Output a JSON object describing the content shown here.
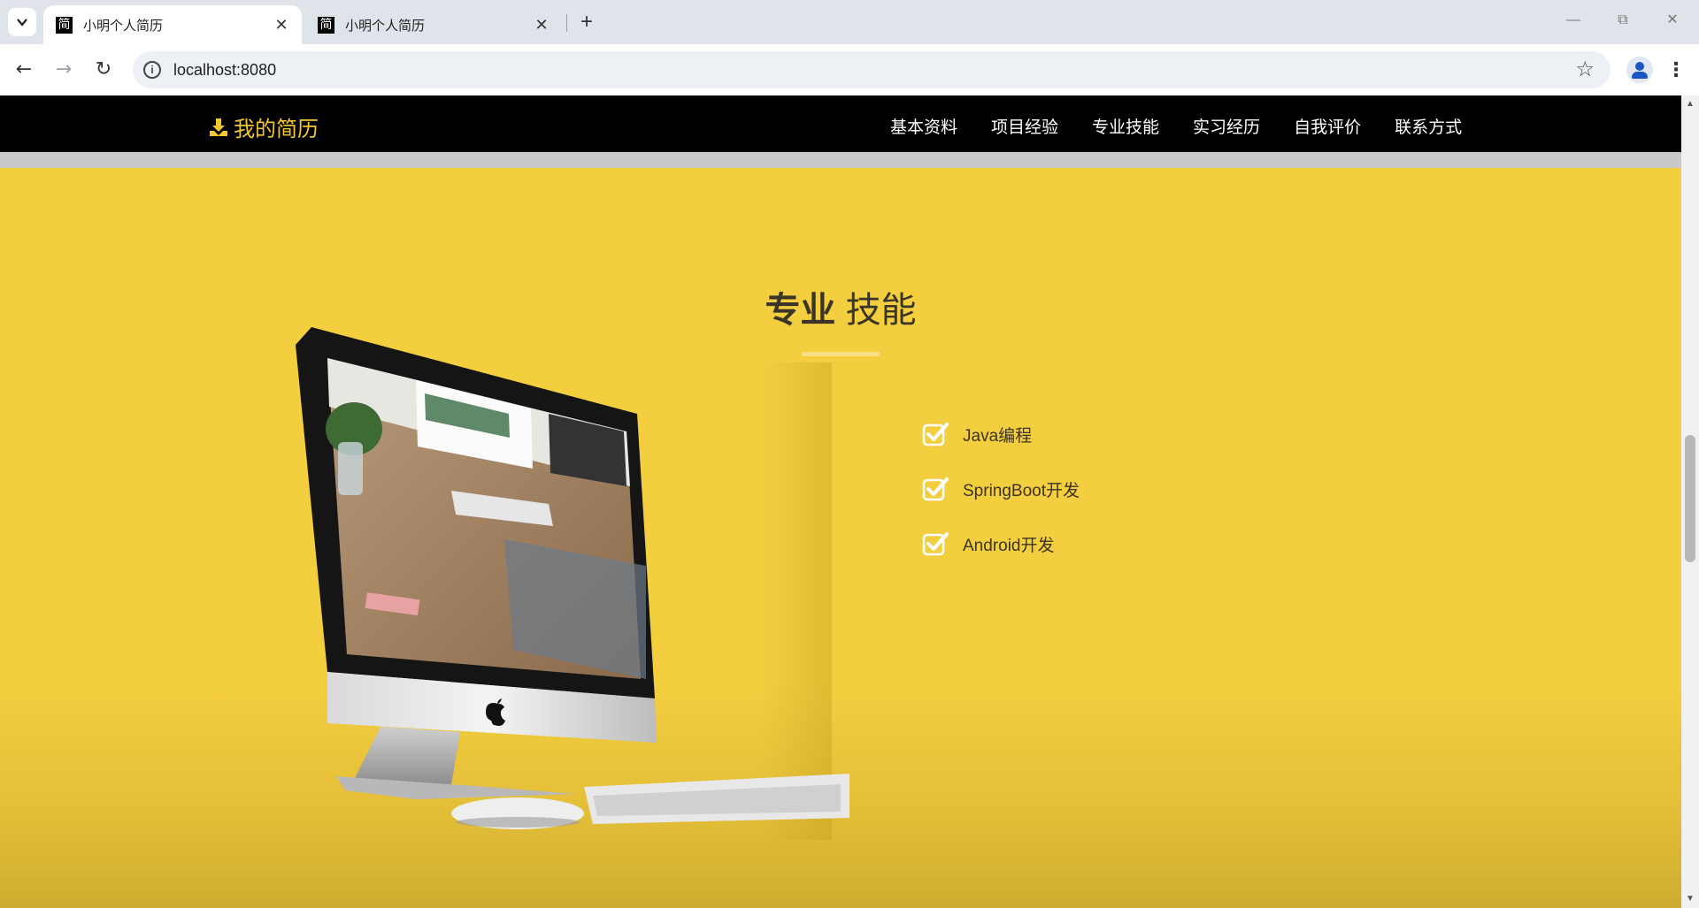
{
  "browser": {
    "tabs": [
      {
        "favicon": "简",
        "title": "小明个人简历",
        "active": true
      },
      {
        "favicon": "简",
        "title": "小明个人简历",
        "active": false
      }
    ],
    "url": "localhost:8080"
  },
  "site": {
    "brand": "我的简历",
    "nav": [
      "基本资料",
      "项目经验",
      "专业技能",
      "实习经历",
      "自我评价",
      "联系方式"
    ]
  },
  "section": {
    "title_bold": "专业",
    "title_rest": "技能",
    "skills": [
      "Java编程",
      "SpringBoot开发",
      "Android开发"
    ]
  },
  "colors": {
    "accent": "#f3ce3f",
    "brand": "#f5c72e",
    "nav_bg": "#000000"
  },
  "icons": [
    "download-icon",
    "check-square-icon",
    "imac-computer-image"
  ]
}
